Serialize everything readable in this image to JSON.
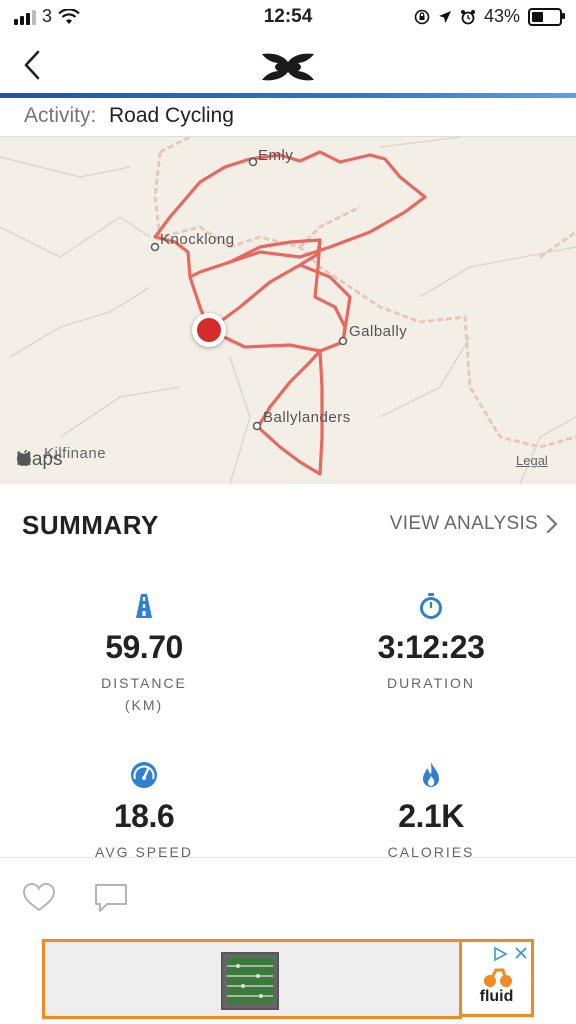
{
  "status_bar": {
    "carrier": "3",
    "time": "12:54",
    "battery_percent": "43%",
    "battery_level": 0.43
  },
  "nav": {
    "back_icon": "chevron-left-icon",
    "logo": "under-armour-logo"
  },
  "activity": {
    "label": "Activity:",
    "value": "Road Cycling"
  },
  "map": {
    "towns": {
      "emly": "Emly",
      "knocklong": "Knocklong",
      "galbally": "Galbally",
      "ballylanders": "Ballylanders",
      "kilfinane": "Kilfinane"
    },
    "brand": "Maps",
    "legal": "Legal",
    "route_color": "#e8675f"
  },
  "summary": {
    "title": "SUMMARY",
    "view_analysis": "VIEW ANALYSIS",
    "stats": [
      {
        "icon": "road-icon",
        "value": "59.70",
        "label": "DISTANCE",
        "unit": "(KM)"
      },
      {
        "icon": "stopwatch-icon",
        "value": "3:12:23",
        "label": "DURATION"
      },
      {
        "icon": "speedometer-icon",
        "value": "18.6",
        "label": "AVG SPEED"
      },
      {
        "icon": "flame-icon",
        "value": "2.1K",
        "label": "CALORIES"
      }
    ]
  },
  "actions": {
    "like_icon": "heart-icon",
    "comment_icon": "comment-icon"
  },
  "ad": {
    "brand": "fluid",
    "accent": "#f08a24"
  }
}
